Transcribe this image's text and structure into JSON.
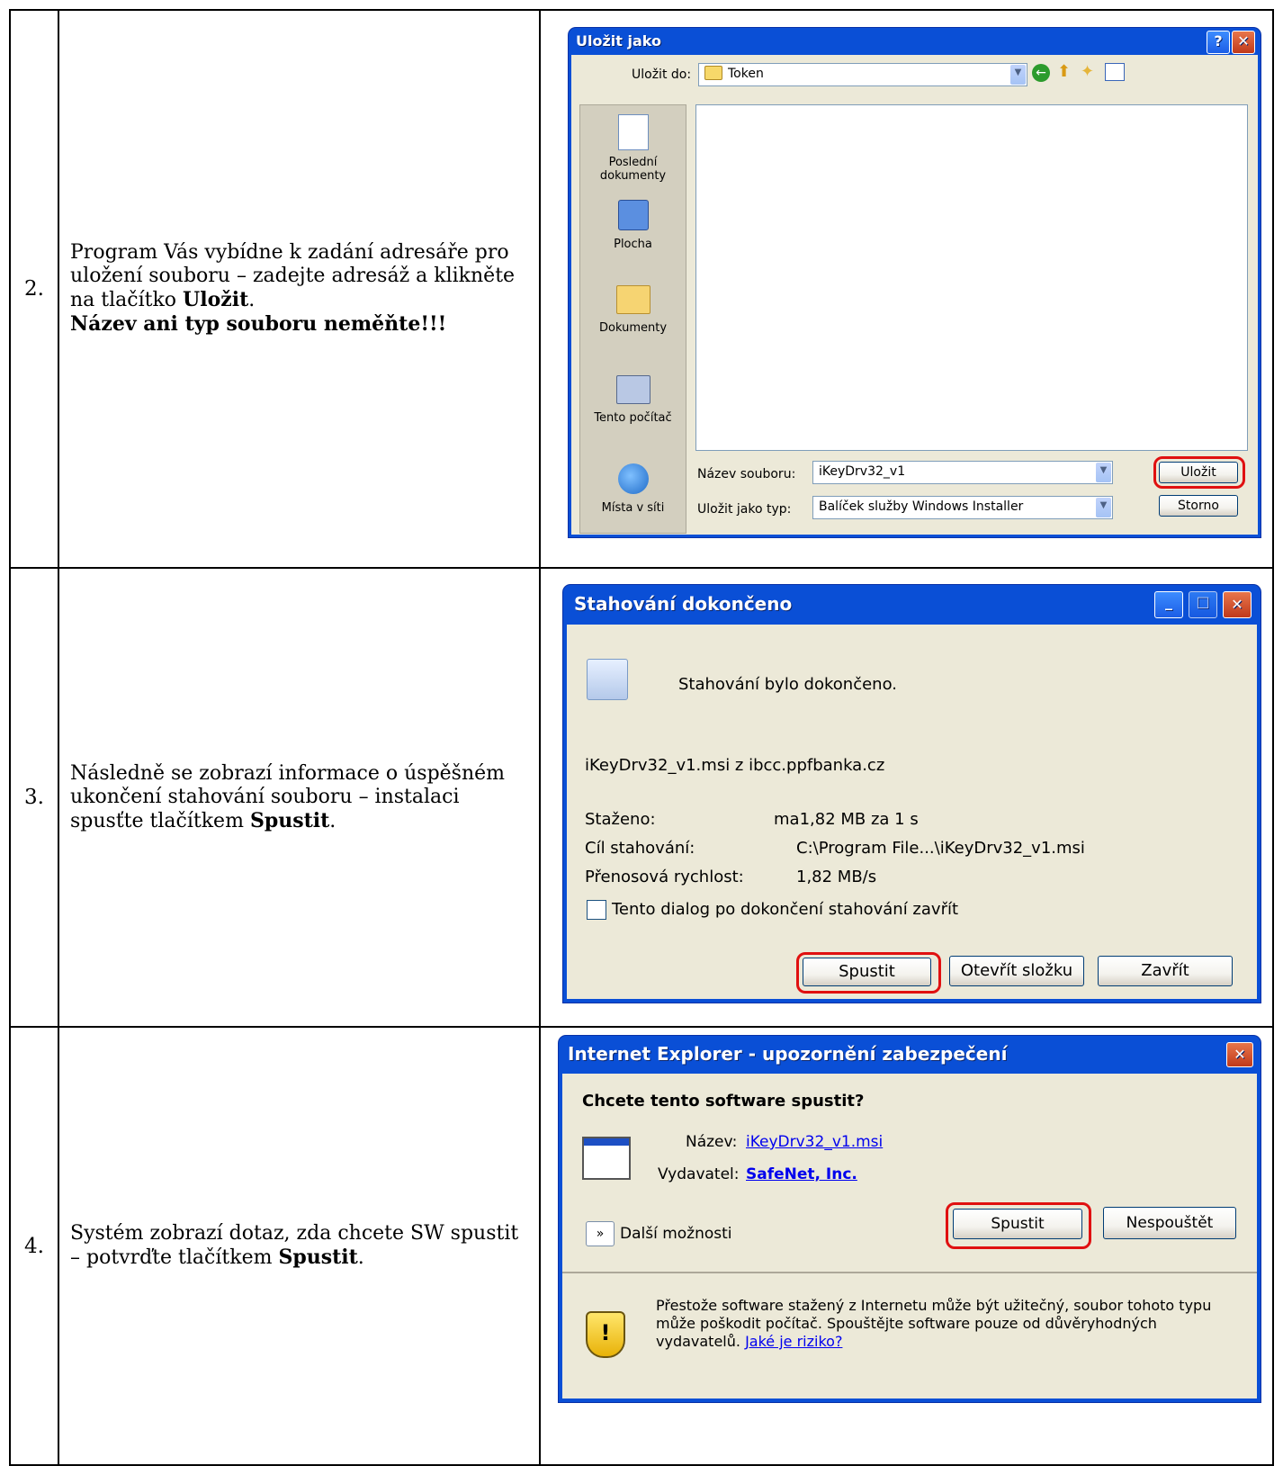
{
  "rows": [
    {
      "num": "2.",
      "text_part1": "Program Vás vybídne k zadání adresáře pro uložení souboru – zadejte adresáž a klikněte na tlačítko ",
      "text_bold1": "Uložit",
      "text_part2": ". ",
      "text_bold2": "Název ani typ souboru neměňte!!!"
    },
    {
      "num": "3.",
      "text_part1": "Následně se zobrazí informace o úspěšném ukončení stahování souboru – instalaci spusťte tlačítkem ",
      "text_bold1": "Spustit",
      "text_part2": "."
    },
    {
      "num": "4.",
      "text_part1": "Systém zobrazí dotaz, zda chcete SW spustit – potvrďte tlačítkem ",
      "text_bold1": "Spustit",
      "text_part2": "."
    }
  ],
  "save_dialog": {
    "title": "Uložit jako",
    "help": "?",
    "close": "✕",
    "save_in_label": "Uložit do:",
    "save_in_value": "Token",
    "places": [
      "Poslední dokumenty",
      "Plocha",
      "Dokumenty",
      "Tento počítač",
      "Místa v síti"
    ],
    "filename_label": "Název souboru:",
    "filename_value": "iKeyDrv32_v1",
    "filetype_label": "Uložit jako typ:",
    "filetype_value": "Balíček služby Windows Installer",
    "save_button": "Uložit",
    "cancel_button": "Storno"
  },
  "download_dialog": {
    "title": "Stahování dokončeno",
    "message": "Stahování bylo dokončeno.",
    "file_source": "iKeyDrv32_v1.msi z ibcc.ppfbanka.cz",
    "downloaded_label": "Staženo:",
    "downloaded_value": "ma1,82 MB za 1 s",
    "target_label": "Cíl stahování:",
    "target_value": "C:\\Program File...\\iKeyDrv32_v1.msi",
    "rate_label": "Přenosová rychlost:",
    "rate_value": "1,82 MB/s",
    "checkbox_label": "Tento dialog po dokončení stahování zavřít",
    "run_button": "Spustit",
    "open_folder_button": "Otevřít složku",
    "close_button": "Zavřít"
  },
  "security_dialog": {
    "title": "Internet Explorer - upozornění zabezpečení",
    "question": "Chcete tento software spustit?",
    "name_label": "Název:",
    "name_value": "iKeyDrv32_v1.msi",
    "publisher_label": "Vydavatel:",
    "publisher_value": "SafeNet, Inc.",
    "more_options": "Další možnosti",
    "run_button": "Spustit",
    "dont_run_button": "Nespouštět",
    "warning_text": "Přestože software stažený z Internetu může být užitečný, soubor tohoto typu může poškodit počítač. Spouštějte software pouze od důvěryhodných vydavatelů.",
    "risk_link": "Jaké je riziko?"
  }
}
